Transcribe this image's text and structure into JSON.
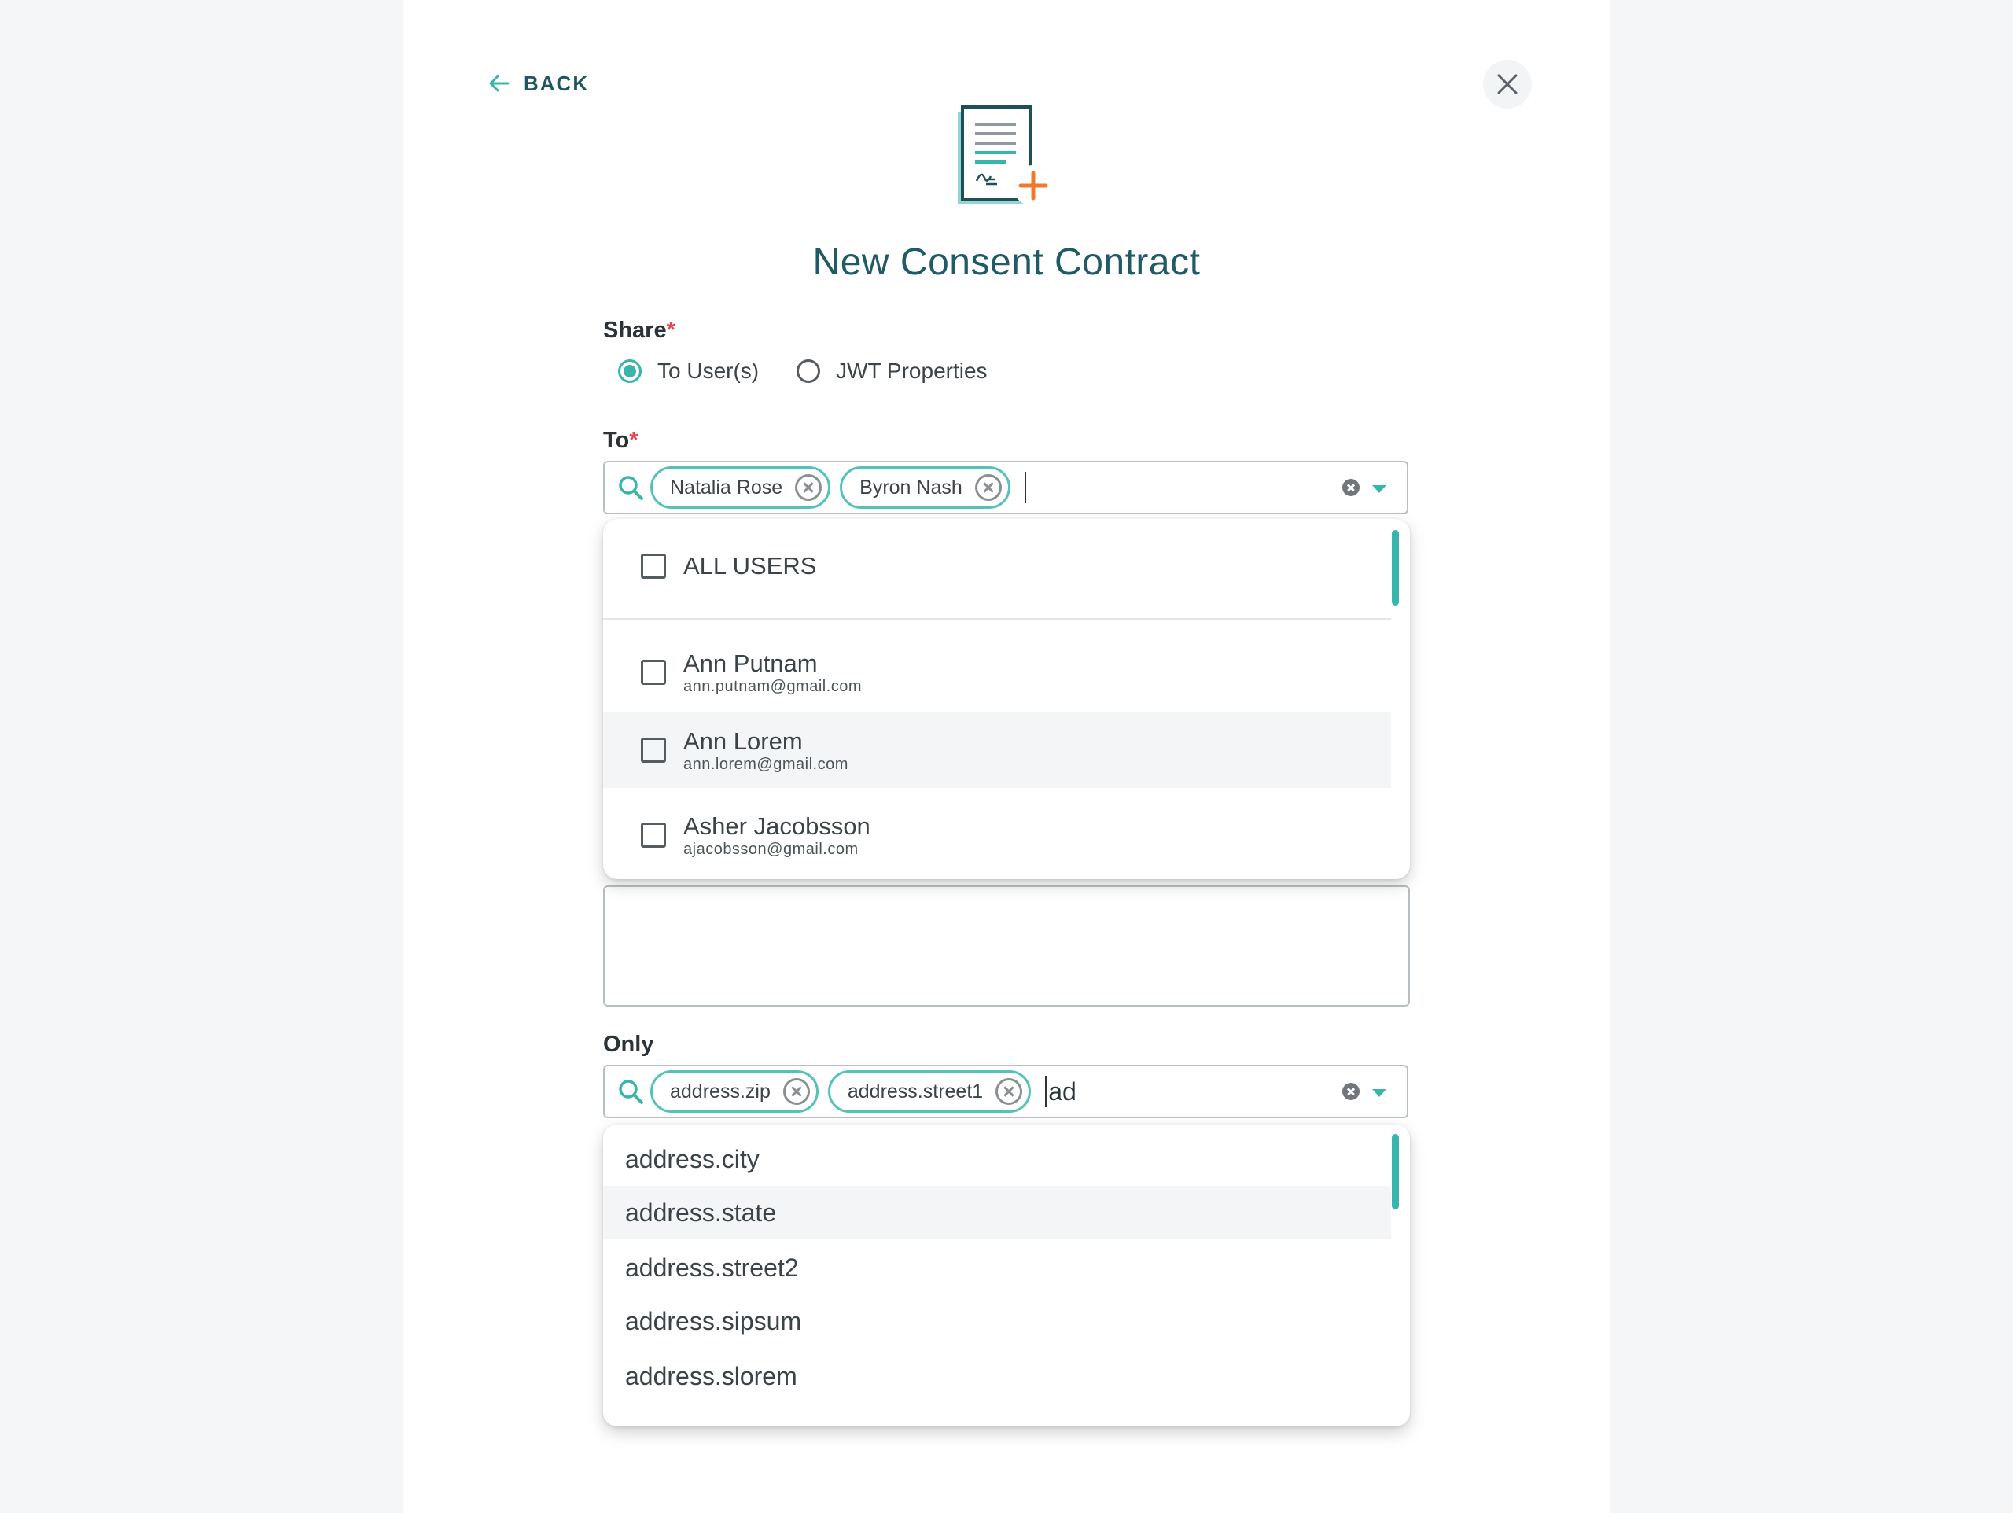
{
  "header": {
    "back_label": "BACK",
    "title": "New Consent Contract"
  },
  "share": {
    "label": "Share",
    "required_mark": "*",
    "options": [
      {
        "label": "To User(s)",
        "selected": true
      },
      {
        "label": "JWT Properties",
        "selected": false
      }
    ]
  },
  "to": {
    "label": "To",
    "required_mark": "*",
    "chips": [
      "Natalia Rose",
      "Byron Nash"
    ],
    "typed": "",
    "dropdown": {
      "all_label": "ALL USERS",
      "users": [
        {
          "name": "Ann Putnam",
          "email": "ann.putnam@gmail.com",
          "highlighted": false
        },
        {
          "name": "Ann Lorem",
          "email": "ann.lorem@gmail.com",
          "highlighted": true
        },
        {
          "name": "Asher Jacobsson",
          "email": "ajacobsson@gmail.com",
          "highlighted": false
        }
      ]
    }
  },
  "only": {
    "label": "Only",
    "chips": [
      "address.zip",
      "address.street1"
    ],
    "typed": "ad",
    "options": [
      "address.city",
      "address.state",
      "address.street2",
      "address.sipsum",
      "address.slorem"
    ],
    "highlighted_option": "address.state"
  },
  "colors": {
    "accent": "#3ab5ac",
    "title": "#1f5a66",
    "required": "#e0484e",
    "doc_plus": "#f07a2c"
  }
}
